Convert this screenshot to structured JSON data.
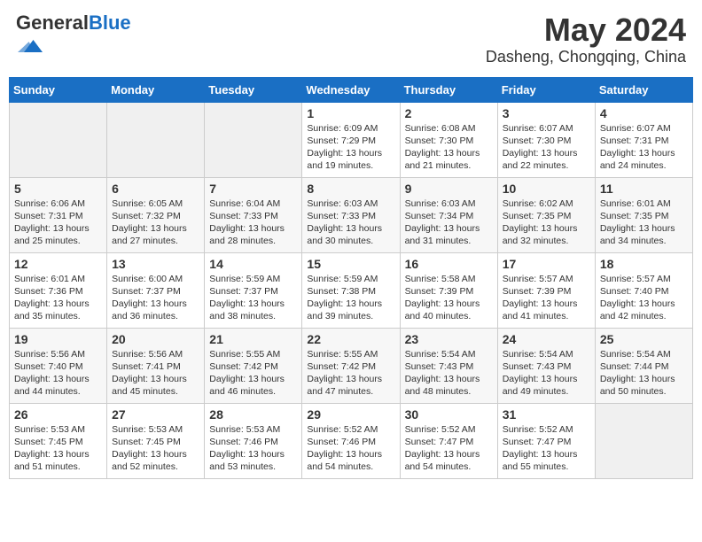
{
  "header": {
    "logo_general": "General",
    "logo_blue": "Blue",
    "month": "May 2024",
    "location": "Dasheng, Chongqing, China"
  },
  "weekdays": [
    "Sunday",
    "Monday",
    "Tuesday",
    "Wednesday",
    "Thursday",
    "Friday",
    "Saturday"
  ],
  "weeks": [
    [
      {
        "day": "",
        "info": ""
      },
      {
        "day": "",
        "info": ""
      },
      {
        "day": "",
        "info": ""
      },
      {
        "day": "1",
        "info": "Sunrise: 6:09 AM\nSunset: 7:29 PM\nDaylight: 13 hours\nand 19 minutes."
      },
      {
        "day": "2",
        "info": "Sunrise: 6:08 AM\nSunset: 7:30 PM\nDaylight: 13 hours\nand 21 minutes."
      },
      {
        "day": "3",
        "info": "Sunrise: 6:07 AM\nSunset: 7:30 PM\nDaylight: 13 hours\nand 22 minutes."
      },
      {
        "day": "4",
        "info": "Sunrise: 6:07 AM\nSunset: 7:31 PM\nDaylight: 13 hours\nand 24 minutes."
      }
    ],
    [
      {
        "day": "5",
        "info": "Sunrise: 6:06 AM\nSunset: 7:31 PM\nDaylight: 13 hours\nand 25 minutes."
      },
      {
        "day": "6",
        "info": "Sunrise: 6:05 AM\nSunset: 7:32 PM\nDaylight: 13 hours\nand 27 minutes."
      },
      {
        "day": "7",
        "info": "Sunrise: 6:04 AM\nSunset: 7:33 PM\nDaylight: 13 hours\nand 28 minutes."
      },
      {
        "day": "8",
        "info": "Sunrise: 6:03 AM\nSunset: 7:33 PM\nDaylight: 13 hours\nand 30 minutes."
      },
      {
        "day": "9",
        "info": "Sunrise: 6:03 AM\nSunset: 7:34 PM\nDaylight: 13 hours\nand 31 minutes."
      },
      {
        "day": "10",
        "info": "Sunrise: 6:02 AM\nSunset: 7:35 PM\nDaylight: 13 hours\nand 32 minutes."
      },
      {
        "day": "11",
        "info": "Sunrise: 6:01 AM\nSunset: 7:35 PM\nDaylight: 13 hours\nand 34 minutes."
      }
    ],
    [
      {
        "day": "12",
        "info": "Sunrise: 6:01 AM\nSunset: 7:36 PM\nDaylight: 13 hours\nand 35 minutes."
      },
      {
        "day": "13",
        "info": "Sunrise: 6:00 AM\nSunset: 7:37 PM\nDaylight: 13 hours\nand 36 minutes."
      },
      {
        "day": "14",
        "info": "Sunrise: 5:59 AM\nSunset: 7:37 PM\nDaylight: 13 hours\nand 38 minutes."
      },
      {
        "day": "15",
        "info": "Sunrise: 5:59 AM\nSunset: 7:38 PM\nDaylight: 13 hours\nand 39 minutes."
      },
      {
        "day": "16",
        "info": "Sunrise: 5:58 AM\nSunset: 7:39 PM\nDaylight: 13 hours\nand 40 minutes."
      },
      {
        "day": "17",
        "info": "Sunrise: 5:57 AM\nSunset: 7:39 PM\nDaylight: 13 hours\nand 41 minutes."
      },
      {
        "day": "18",
        "info": "Sunrise: 5:57 AM\nSunset: 7:40 PM\nDaylight: 13 hours\nand 42 minutes."
      }
    ],
    [
      {
        "day": "19",
        "info": "Sunrise: 5:56 AM\nSunset: 7:40 PM\nDaylight: 13 hours\nand 44 minutes."
      },
      {
        "day": "20",
        "info": "Sunrise: 5:56 AM\nSunset: 7:41 PM\nDaylight: 13 hours\nand 45 minutes."
      },
      {
        "day": "21",
        "info": "Sunrise: 5:55 AM\nSunset: 7:42 PM\nDaylight: 13 hours\nand 46 minutes."
      },
      {
        "day": "22",
        "info": "Sunrise: 5:55 AM\nSunset: 7:42 PM\nDaylight: 13 hours\nand 47 minutes."
      },
      {
        "day": "23",
        "info": "Sunrise: 5:54 AM\nSunset: 7:43 PM\nDaylight: 13 hours\nand 48 minutes."
      },
      {
        "day": "24",
        "info": "Sunrise: 5:54 AM\nSunset: 7:43 PM\nDaylight: 13 hours\nand 49 minutes."
      },
      {
        "day": "25",
        "info": "Sunrise: 5:54 AM\nSunset: 7:44 PM\nDaylight: 13 hours\nand 50 minutes."
      }
    ],
    [
      {
        "day": "26",
        "info": "Sunrise: 5:53 AM\nSunset: 7:45 PM\nDaylight: 13 hours\nand 51 minutes."
      },
      {
        "day": "27",
        "info": "Sunrise: 5:53 AM\nSunset: 7:45 PM\nDaylight: 13 hours\nand 52 minutes."
      },
      {
        "day": "28",
        "info": "Sunrise: 5:53 AM\nSunset: 7:46 PM\nDaylight: 13 hours\nand 53 minutes."
      },
      {
        "day": "29",
        "info": "Sunrise: 5:52 AM\nSunset: 7:46 PM\nDaylight: 13 hours\nand 54 minutes."
      },
      {
        "day": "30",
        "info": "Sunrise: 5:52 AM\nSunset: 7:47 PM\nDaylight: 13 hours\nand 54 minutes."
      },
      {
        "day": "31",
        "info": "Sunrise: 5:52 AM\nSunset: 7:47 PM\nDaylight: 13 hours\nand 55 minutes."
      },
      {
        "day": "",
        "info": ""
      }
    ]
  ]
}
